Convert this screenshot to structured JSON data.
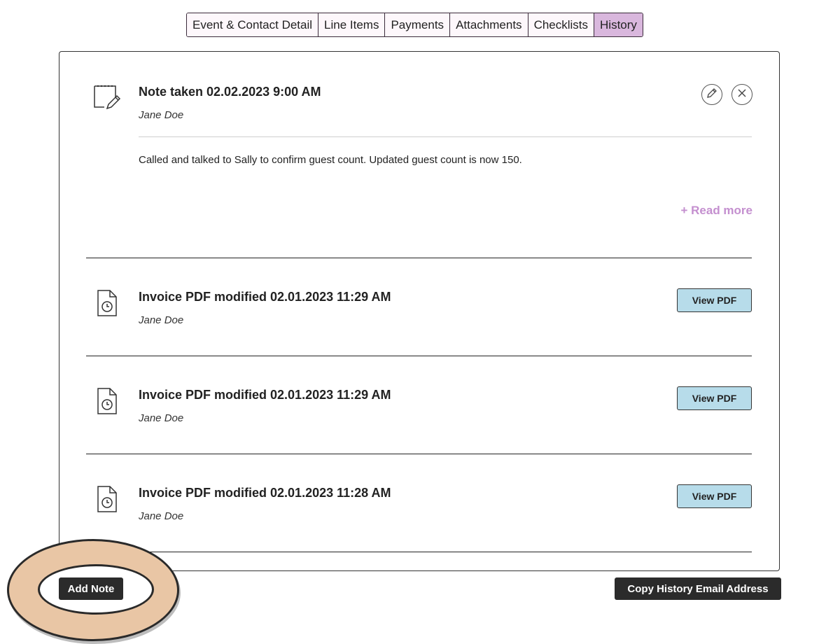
{
  "tabs": [
    {
      "label": "Event & Contact Detail",
      "active": false
    },
    {
      "label": "Line Items",
      "active": false
    },
    {
      "label": "Payments",
      "active": false
    },
    {
      "label": "Attachments",
      "active": false
    },
    {
      "label": "Checklists",
      "active": false
    },
    {
      "label": "History",
      "active": true
    }
  ],
  "note": {
    "icon": "notepad-pencil-icon",
    "title": "Note taken 02.02.2023 9:00 AM",
    "author": "Jane Doe",
    "body": "Called and talked to Sally to confirm guest count. Updated guest count is now 150.",
    "read_more_label": "+ Read more",
    "actions": [
      "edit-icon",
      "close-icon"
    ]
  },
  "history_items": [
    {
      "icon": "document-clock-icon",
      "title": "Invoice PDF modified 02.01.2023 11:29 AM",
      "author": "Jane Doe",
      "button_label": "View PDF"
    },
    {
      "icon": "document-clock-icon",
      "title": "Invoice PDF modified 02.01.2023 11:29 AM",
      "author": "Jane Doe",
      "button_label": "View PDF"
    },
    {
      "icon": "document-clock-icon",
      "title": "Invoice PDF modified 02.01.2023 11:28 AM",
      "author": "Jane Doe",
      "button_label": "View PDF"
    }
  ],
  "footer": {
    "add_note_label": "Add Note",
    "copy_email_label": "Copy History Email Address"
  },
  "colors": {
    "active_tab": "#d9b7dd",
    "tab_bg": "#fdf7fb",
    "read_more": "#c48fcf",
    "view_button": "#b7dcea",
    "dark_button": "#2b2b2b",
    "highlight": "#e9c6a5"
  }
}
